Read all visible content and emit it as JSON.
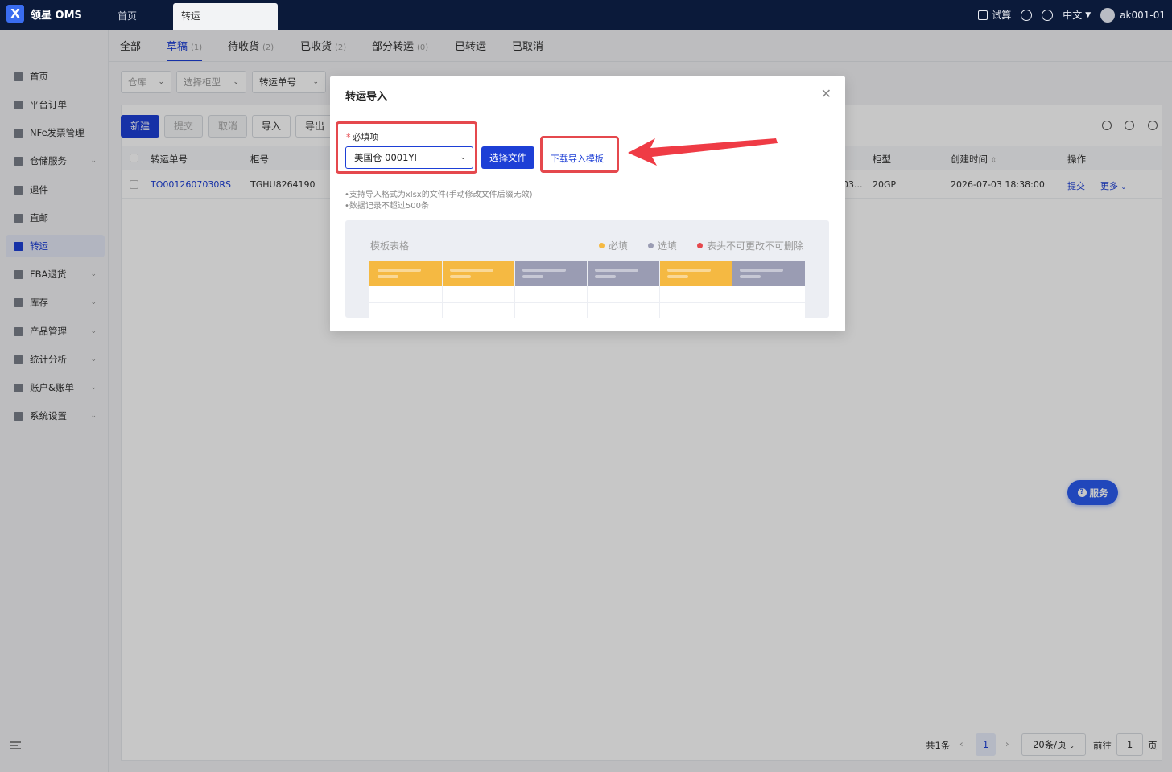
{
  "app": {
    "logo_letter": "X",
    "name": "领星 OMS"
  },
  "tabs": {
    "home": "首页",
    "transfer": "转运"
  },
  "topbar": {
    "calc": "试算",
    "lang": "中文",
    "user": "ak001-01"
  },
  "sidebar": {
    "items": [
      {
        "label": "首页",
        "icon": "home-icon"
      },
      {
        "label": "平台订单",
        "icon": "order-icon"
      },
      {
        "label": "NFe发票管理",
        "icon": "invoice-icon"
      },
      {
        "label": "仓储服务",
        "icon": "warehouse-icon",
        "expandable": true
      },
      {
        "label": "退件",
        "icon": "return-icon"
      },
      {
        "label": "直邮",
        "icon": "direct-mail-icon"
      },
      {
        "label": "转运",
        "icon": "transfer-icon",
        "active": true
      },
      {
        "label": "FBA退货",
        "icon": "fba-return-icon",
        "expandable": true
      },
      {
        "label": "库存",
        "icon": "inventory-icon",
        "expandable": true
      },
      {
        "label": "产品管理",
        "icon": "product-icon",
        "expandable": true
      },
      {
        "label": "统计分析",
        "icon": "stats-icon",
        "expandable": true
      },
      {
        "label": "账户&账单",
        "icon": "account-icon",
        "expandable": true
      },
      {
        "label": "系统设置",
        "icon": "settings-icon",
        "expandable": true
      }
    ]
  },
  "status_tabs": [
    {
      "label": "全部",
      "count": ""
    },
    {
      "label": "草稿",
      "count": "(1)",
      "active": true
    },
    {
      "label": "待收货",
      "count": "(2)"
    },
    {
      "label": "已收货",
      "count": "(2)"
    },
    {
      "label": "部分转运",
      "count": "(0)"
    },
    {
      "label": "已转运",
      "count": ""
    },
    {
      "label": "已取消",
      "count": ""
    }
  ],
  "filters": {
    "warehouse": "仓库",
    "container_type": "选择柜型",
    "transfer_no": "转运单号"
  },
  "actions": {
    "new": "新建",
    "submit": "提交",
    "cancel": "取消",
    "import": "导入",
    "export": "导出"
  },
  "table": {
    "headers": {
      "no": "转运单号",
      "container_no": "柜号",
      "container_type": "柜型",
      "created": "创建时间",
      "ops": "操作"
    },
    "rows": [
      {
        "no": "TO0012607030RS",
        "container_no": "TGHU8264190",
        "extra": "03...",
        "container_type": "20GP",
        "created": "2026-07-03 18:38:00",
        "op_submit": "提交",
        "op_more": "更多"
      }
    ]
  },
  "pagination": {
    "total": "共1条",
    "page": "1",
    "page_size": "20条/页",
    "goto_label": "前往",
    "goto_value": "1",
    "page_unit": "页"
  },
  "service": {
    "label": "服务"
  },
  "modal": {
    "title": "转运导入",
    "required_label": "必填项",
    "warehouse_value": "美国仓 0001YI",
    "choose_file": "选择文件",
    "download_template": "下载导入模板",
    "tip1": "•支持导入格式为xlsx的文件(手动修改文件后缀无效)",
    "tip2": "•数据记录不超过500条",
    "template": {
      "title": "模板表格",
      "legend_required": "必填",
      "legend_optional": "选填",
      "legend_fixed": "表头不可更改不可删除"
    }
  },
  "colors": {
    "primary": "#1d3fd6",
    "required": "#f5b942",
    "optional": "#9a9cb3",
    "fixed": "#e5484d",
    "highlight": "#e5484d"
  }
}
